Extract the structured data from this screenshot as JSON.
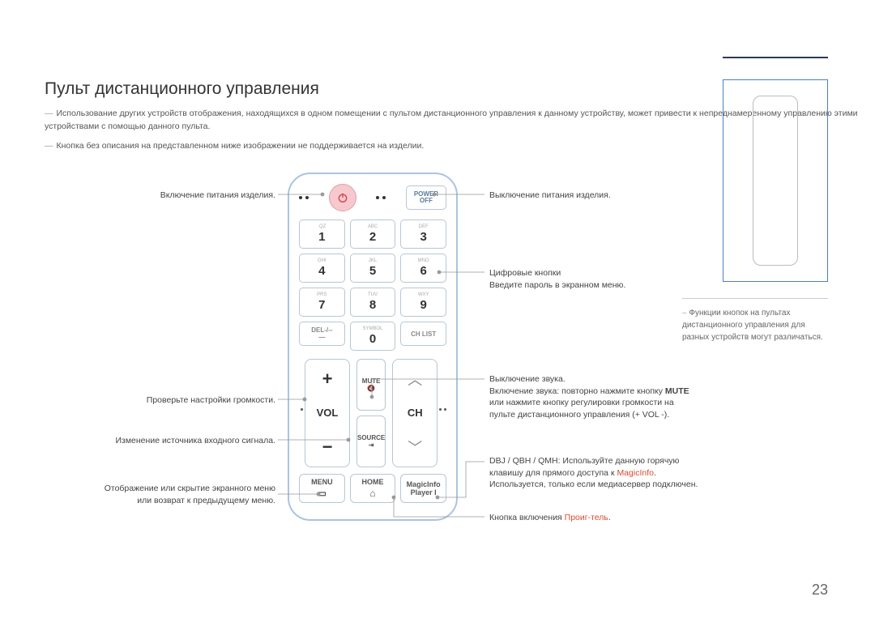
{
  "page": {
    "number": "23"
  },
  "title": "Пульт дистанционного управления",
  "notes": {
    "n1": "Использование других устройств отображения, находящихся в одном помещении с пультом дистанционного управления к данному устройству, может привести к непреднамеренному управлению этими устройствами с помощью данного пульта.",
    "n2": "Кнопка без описания на представленном ниже изображении не поддерживается на изделии."
  },
  "remote": {
    "poweroff_top": "POWER",
    "poweroff_bot": "OFF",
    "keys": {
      "k1s": ".QZ",
      "k1": "1",
      "k2s": "ABC",
      "k2": "2",
      "k3s": "DEF",
      "k3": "3",
      "k4s": "GHI",
      "k4": "4",
      "k5s": "JKL",
      "k5": "5",
      "k6s": "MNO",
      "k6": "6",
      "k7s": "PRS",
      "k7": "7",
      "k8s": "TUV",
      "k8": "8",
      "k9s": "WXY",
      "k9": "9",
      "del": "DEL-/--",
      "dash": "—",
      "sym": "SYMBOL",
      "k0": "0",
      "chlist": "CH LIST"
    },
    "vol": "VOL",
    "ch": "CH",
    "mute": "MUTE",
    "source": "SOURCE",
    "menu": "MENU",
    "home": "HOME",
    "magic1": "MagicInfo",
    "magic2": "Player I",
    "plus": "+",
    "minus": "−",
    "up": "︿",
    "down": "﹀"
  },
  "labels": {
    "l_power": "Включение питания изделия.",
    "l_vol": "Проверьте настройки громкости.",
    "l_src": "Изменение источника входного сигнала.",
    "l_menu1": "Отображение или скрытие экранного меню",
    "l_menu2": "или возврат к предыдущему меню.",
    "r_pwroff": "Выключение питания изделия.",
    "r_num1": "Цифровые кнопки",
    "r_num2": "Введите пароль в экранном меню.",
    "r_mute1": "Выключение звука.",
    "r_mute2a": "Включение звука: повторно нажмите кнопку ",
    "r_mute2b": "MUTE",
    "r_mute2c": " или нажмите кнопку регулировки громкости на пульте дистанционного управления (+ VOL -).",
    "r_magic1": "DBJ / QBH / QMH: Используйте данную горячую клавишу для прямого доступа к ",
    "r_magic_red": "MagicInfo",
    "r_magic2": ". Используется, только если медиасервер подключен.",
    "r_player1": "Кнопка включения ",
    "r_player_red": "Проиг-тель",
    "r_player2": "."
  },
  "sidebar": {
    "text": "Функции кнопок на пультах дистанционного управления для разных устройств могут различаться."
  }
}
